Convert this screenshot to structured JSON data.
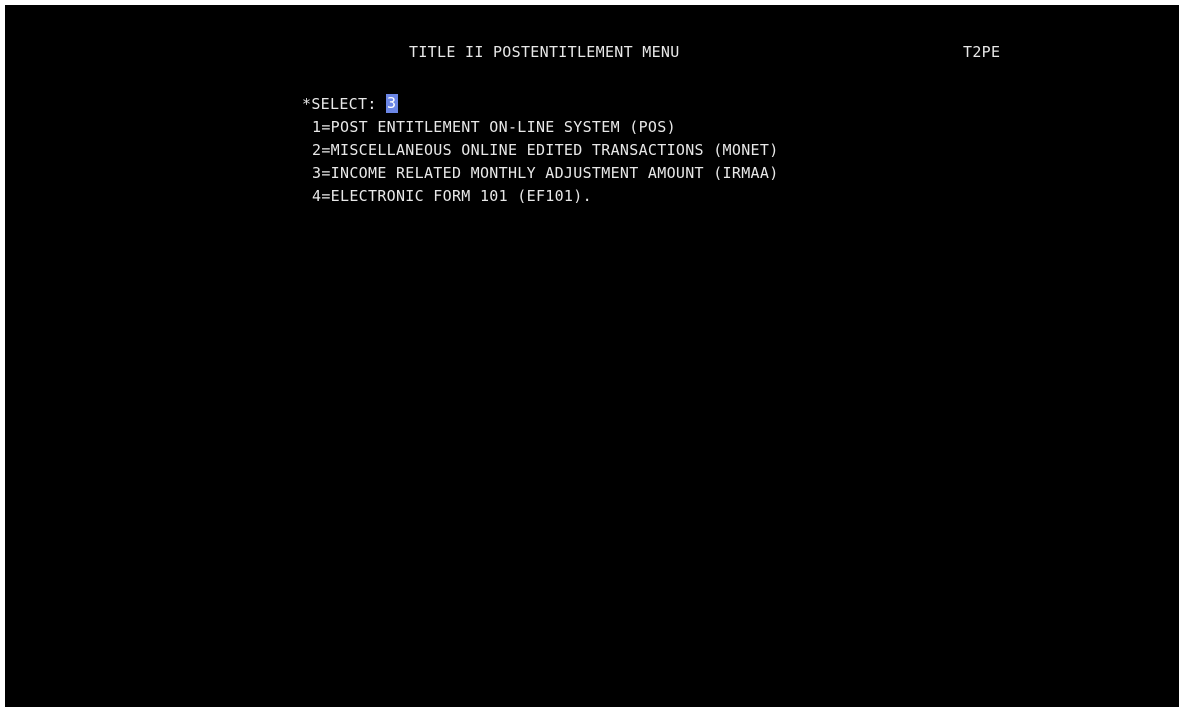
{
  "screen": {
    "title": "TITLE II POSTENTITLEMENT MENU",
    "screen_id": "T2PE"
  },
  "select": {
    "label": "*SELECT: ",
    "value": "3"
  },
  "options": [
    {
      "text": "1=POST ENTITLEMENT ON-LINE SYSTEM (POS)"
    },
    {
      "text": "2=MISCELLANEOUS ONLINE EDITED TRANSACTIONS (MONET)"
    },
    {
      "text": "3=INCOME RELATED MONTHLY ADJUSTMENT AMOUNT (IRMAA)"
    },
    {
      "text": "4=ELECTRONIC FORM 101 (EF101)."
    }
  ],
  "colors": {
    "background": "#000000",
    "text": "#e8e8e8",
    "input_highlight": "#6b86e6"
  }
}
